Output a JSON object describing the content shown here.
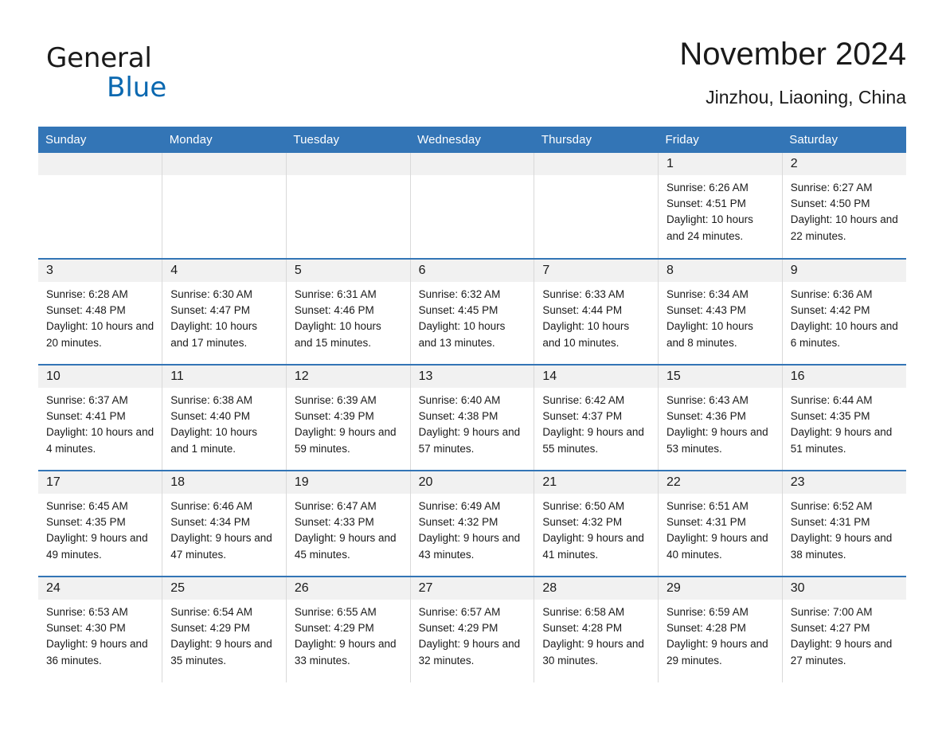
{
  "brand": {
    "logo_line1": "General",
    "logo_line2": "Blue",
    "logo_icon": "triangle-flag-icon",
    "accent_color": "#0a68b0"
  },
  "header": {
    "month_title": "November 2024",
    "location": "Jinzhou, Liaoning, China"
  },
  "colors": {
    "header_blue": "#3375b6",
    "daynum_background": "#f1f1f1",
    "cell_border": "#d9d9d9"
  },
  "calendar": {
    "weekday_headers": [
      "Sunday",
      "Monday",
      "Tuesday",
      "Wednesday",
      "Thursday",
      "Friday",
      "Saturday"
    ],
    "weeks": [
      [
        {
          "day": "",
          "sunrise": "",
          "sunset": "",
          "daylight": "",
          "empty": true
        },
        {
          "day": "",
          "sunrise": "",
          "sunset": "",
          "daylight": "",
          "empty": true
        },
        {
          "day": "",
          "sunrise": "",
          "sunset": "",
          "daylight": "",
          "empty": true
        },
        {
          "day": "",
          "sunrise": "",
          "sunset": "",
          "daylight": "",
          "empty": true
        },
        {
          "day": "",
          "sunrise": "",
          "sunset": "",
          "daylight": "",
          "empty": true
        },
        {
          "day": "1",
          "sunrise": "Sunrise: 6:26 AM",
          "sunset": "Sunset: 4:51 PM",
          "daylight": "Daylight: 10 hours and 24 minutes.",
          "empty": false
        },
        {
          "day": "2",
          "sunrise": "Sunrise: 6:27 AM",
          "sunset": "Sunset: 4:50 PM",
          "daylight": "Daylight: 10 hours and 22 minutes.",
          "empty": false
        }
      ],
      [
        {
          "day": "3",
          "sunrise": "Sunrise: 6:28 AM",
          "sunset": "Sunset: 4:48 PM",
          "daylight": "Daylight: 10 hours and 20 minutes.",
          "empty": false
        },
        {
          "day": "4",
          "sunrise": "Sunrise: 6:30 AM",
          "sunset": "Sunset: 4:47 PM",
          "daylight": "Daylight: 10 hours and 17 minutes.",
          "empty": false
        },
        {
          "day": "5",
          "sunrise": "Sunrise: 6:31 AM",
          "sunset": "Sunset: 4:46 PM",
          "daylight": "Daylight: 10 hours and 15 minutes.",
          "empty": false
        },
        {
          "day": "6",
          "sunrise": "Sunrise: 6:32 AM",
          "sunset": "Sunset: 4:45 PM",
          "daylight": "Daylight: 10 hours and 13 minutes.",
          "empty": false
        },
        {
          "day": "7",
          "sunrise": "Sunrise: 6:33 AM",
          "sunset": "Sunset: 4:44 PM",
          "daylight": "Daylight: 10 hours and 10 minutes.",
          "empty": false
        },
        {
          "day": "8",
          "sunrise": "Sunrise: 6:34 AM",
          "sunset": "Sunset: 4:43 PM",
          "daylight": "Daylight: 10 hours and 8 minutes.",
          "empty": false
        },
        {
          "day": "9",
          "sunrise": "Sunrise: 6:36 AM",
          "sunset": "Sunset: 4:42 PM",
          "daylight": "Daylight: 10 hours and 6 minutes.",
          "empty": false
        }
      ],
      [
        {
          "day": "10",
          "sunrise": "Sunrise: 6:37 AM",
          "sunset": "Sunset: 4:41 PM",
          "daylight": "Daylight: 10 hours and 4 minutes.",
          "empty": false
        },
        {
          "day": "11",
          "sunrise": "Sunrise: 6:38 AM",
          "sunset": "Sunset: 4:40 PM",
          "daylight": "Daylight: 10 hours and 1 minute.",
          "empty": false
        },
        {
          "day": "12",
          "sunrise": "Sunrise: 6:39 AM",
          "sunset": "Sunset: 4:39 PM",
          "daylight": "Daylight: 9 hours and 59 minutes.",
          "empty": false
        },
        {
          "day": "13",
          "sunrise": "Sunrise: 6:40 AM",
          "sunset": "Sunset: 4:38 PM",
          "daylight": "Daylight: 9 hours and 57 minutes.",
          "empty": false
        },
        {
          "day": "14",
          "sunrise": "Sunrise: 6:42 AM",
          "sunset": "Sunset: 4:37 PM",
          "daylight": "Daylight: 9 hours and 55 minutes.",
          "empty": false
        },
        {
          "day": "15",
          "sunrise": "Sunrise: 6:43 AM",
          "sunset": "Sunset: 4:36 PM",
          "daylight": "Daylight: 9 hours and 53 minutes.",
          "empty": false
        },
        {
          "day": "16",
          "sunrise": "Sunrise: 6:44 AM",
          "sunset": "Sunset: 4:35 PM",
          "daylight": "Daylight: 9 hours and 51 minutes.",
          "empty": false
        }
      ],
      [
        {
          "day": "17",
          "sunrise": "Sunrise: 6:45 AM",
          "sunset": "Sunset: 4:35 PM",
          "daylight": "Daylight: 9 hours and 49 minutes.",
          "empty": false
        },
        {
          "day": "18",
          "sunrise": "Sunrise: 6:46 AM",
          "sunset": "Sunset: 4:34 PM",
          "daylight": "Daylight: 9 hours and 47 minutes.",
          "empty": false
        },
        {
          "day": "19",
          "sunrise": "Sunrise: 6:47 AM",
          "sunset": "Sunset: 4:33 PM",
          "daylight": "Daylight: 9 hours and 45 minutes.",
          "empty": false
        },
        {
          "day": "20",
          "sunrise": "Sunrise: 6:49 AM",
          "sunset": "Sunset: 4:32 PM",
          "daylight": "Daylight: 9 hours and 43 minutes.",
          "empty": false
        },
        {
          "day": "21",
          "sunrise": "Sunrise: 6:50 AM",
          "sunset": "Sunset: 4:32 PM",
          "daylight": "Daylight: 9 hours and 41 minutes.",
          "empty": false
        },
        {
          "day": "22",
          "sunrise": "Sunrise: 6:51 AM",
          "sunset": "Sunset: 4:31 PM",
          "daylight": "Daylight: 9 hours and 40 minutes.",
          "empty": false
        },
        {
          "day": "23",
          "sunrise": "Sunrise: 6:52 AM",
          "sunset": "Sunset: 4:31 PM",
          "daylight": "Daylight: 9 hours and 38 minutes.",
          "empty": false
        }
      ],
      [
        {
          "day": "24",
          "sunrise": "Sunrise: 6:53 AM",
          "sunset": "Sunset: 4:30 PM",
          "daylight": "Daylight: 9 hours and 36 minutes.",
          "empty": false
        },
        {
          "day": "25",
          "sunrise": "Sunrise: 6:54 AM",
          "sunset": "Sunset: 4:29 PM",
          "daylight": "Daylight: 9 hours and 35 minutes.",
          "empty": false
        },
        {
          "day": "26",
          "sunrise": "Sunrise: 6:55 AM",
          "sunset": "Sunset: 4:29 PM",
          "daylight": "Daylight: 9 hours and 33 minutes.",
          "empty": false
        },
        {
          "day": "27",
          "sunrise": "Sunrise: 6:57 AM",
          "sunset": "Sunset: 4:29 PM",
          "daylight": "Daylight: 9 hours and 32 minutes.",
          "empty": false
        },
        {
          "day": "28",
          "sunrise": "Sunrise: 6:58 AM",
          "sunset": "Sunset: 4:28 PM",
          "daylight": "Daylight: 9 hours and 30 minutes.",
          "empty": false
        },
        {
          "day": "29",
          "sunrise": "Sunrise: 6:59 AM",
          "sunset": "Sunset: 4:28 PM",
          "daylight": "Daylight: 9 hours and 29 minutes.",
          "empty": false
        },
        {
          "day": "30",
          "sunrise": "Sunrise: 7:00 AM",
          "sunset": "Sunset: 4:27 PM",
          "daylight": "Daylight: 9 hours and 27 minutes.",
          "empty": false
        }
      ]
    ]
  }
}
